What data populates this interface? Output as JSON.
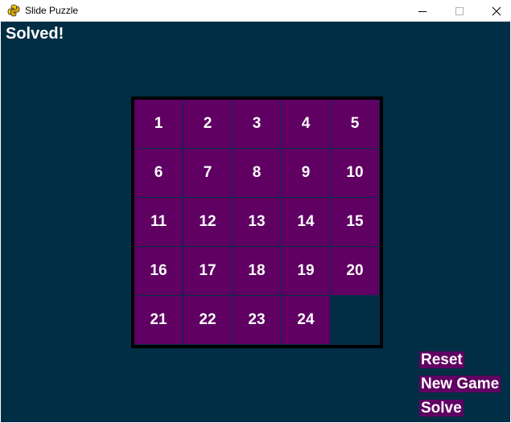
{
  "window": {
    "title": "Slide Puzzle",
    "icon": "python-icon",
    "controls": [
      "minimize",
      "maximize",
      "close"
    ]
  },
  "game": {
    "status": "Solved!",
    "grid_size": 5,
    "tiles": [
      "1",
      "2",
      "3",
      "4",
      "5",
      "6",
      "7",
      "8",
      "9",
      "10",
      "11",
      "12",
      "13",
      "14",
      "15",
      "16",
      "17",
      "18",
      "19",
      "20",
      "21",
      "22",
      "23",
      "24",
      ""
    ]
  },
  "buttons": {
    "reset": "Reset",
    "new_game": "New Game",
    "solve": "Solve"
  },
  "colors": {
    "background": "#012e45",
    "tile": "#5f0062",
    "tile_text": "#ffffff",
    "board_border": "#000000"
  }
}
